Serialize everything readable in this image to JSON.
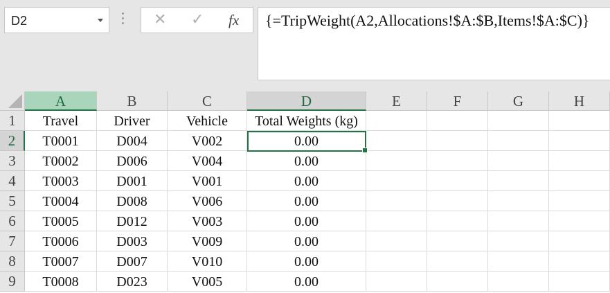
{
  "name_box": {
    "value": "D2"
  },
  "formula_bar": {
    "cancel_glyph": "✕",
    "enter_glyph": "✓",
    "fx_label": "fx",
    "formula": "{=TripWeight(A2,Allocations!$A:$B,Items!$A:$C)}"
  },
  "columns": [
    "A",
    "B",
    "C",
    "D",
    "E",
    "F",
    "G",
    "H"
  ],
  "rows": [
    "1",
    "2",
    "3",
    "4",
    "5",
    "6",
    "7",
    "8",
    "9"
  ],
  "headers": {
    "a": "Travel",
    "b": "Driver",
    "c": "Vehicle",
    "d": "Total Weights (kg)"
  },
  "data": [
    {
      "a": "T0001",
      "b": "D004",
      "c": "V002",
      "d": "0.00"
    },
    {
      "a": "T0002",
      "b": "D006",
      "c": "V004",
      "d": "0.00"
    },
    {
      "a": "T0003",
      "b": "D001",
      "c": "V001",
      "d": "0.00"
    },
    {
      "a": "T0004",
      "b": "D008",
      "c": "V006",
      "d": "0.00"
    },
    {
      "a": "T0005",
      "b": "D012",
      "c": "V003",
      "d": "0.00"
    },
    {
      "a": "T0006",
      "b": "D003",
      "c": "V009",
      "d": "0.00"
    },
    {
      "a": "T0007",
      "b": "D007",
      "c": "V010",
      "d": "0.00"
    },
    {
      "a": "T0008",
      "b": "D023",
      "c": "V005",
      "d": "0.00"
    }
  ],
  "active_cell": "D2",
  "colors": {
    "accent": "#217346",
    "header_bg": "#e6e6e6",
    "selected_col_bg": "#a8d5bc"
  }
}
